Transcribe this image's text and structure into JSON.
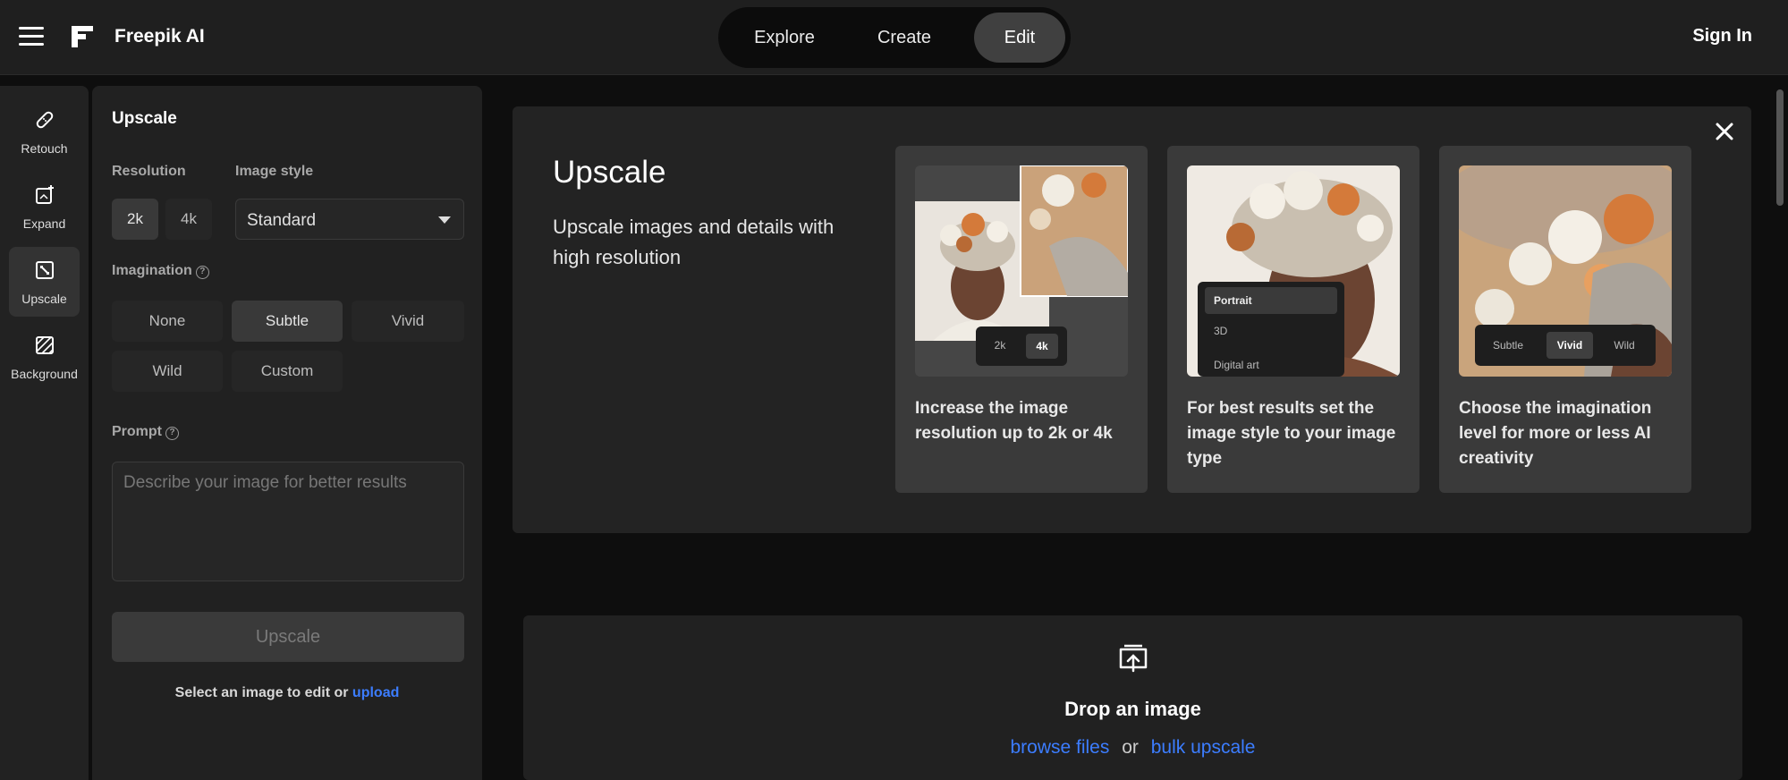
{
  "header": {
    "brand": "Freepik AI",
    "tabs": [
      {
        "label": "Explore"
      },
      {
        "label": "Create"
      },
      {
        "label": "Edit"
      }
    ],
    "active_tab": "Edit",
    "sign_in": "Sign In"
  },
  "rail": {
    "items": [
      {
        "label": "Retouch",
        "icon": "bandage-icon"
      },
      {
        "label": "Expand",
        "icon": "expand-icon"
      },
      {
        "label": "Upscale",
        "icon": "upscale-icon"
      },
      {
        "label": "Background",
        "icon": "background-icon"
      }
    ],
    "active": "Upscale"
  },
  "panel": {
    "title": "Upscale",
    "resolution_label": "Resolution",
    "resolution_options": [
      "2k",
      "4k"
    ],
    "resolution_selected": "2k",
    "style_label": "Image style",
    "style_value": "Standard",
    "imagination_label": "Imagination",
    "imagination_options": [
      "None",
      "Subtle",
      "Vivid",
      "Wild",
      "Custom"
    ],
    "imagination_selected": "Subtle",
    "prompt_label": "Prompt",
    "prompt_placeholder": "Describe your image for better results",
    "button": "Upscale",
    "hint_text": "Select an image to edit or",
    "hint_link": "upload"
  },
  "info": {
    "title": "Upscale",
    "description": "Upscale images and details with high resolution",
    "cards": [
      {
        "text": "Increase the image resolution up to 2k or 4k",
        "overlay": [
          "2k",
          "4k"
        ],
        "overlay_selected": "4k"
      },
      {
        "text": "For best results set the image style to your image type",
        "overlay": [
          "Portrait",
          "3D",
          "Digital art"
        ],
        "overlay_selected": "Portrait"
      },
      {
        "text": "Choose the imagination level for more or less AI creativity",
        "overlay": [
          "Subtle",
          "Vivid",
          "Wild"
        ],
        "overlay_selected": "Vivid"
      }
    ]
  },
  "drop": {
    "title": "Drop an image",
    "link1": "browse files",
    "or": "or",
    "link2": "bulk upscale"
  },
  "colors": {
    "accent_link": "#3c7dff",
    "bg": "#0e0e0e",
    "panel": "#212121"
  }
}
